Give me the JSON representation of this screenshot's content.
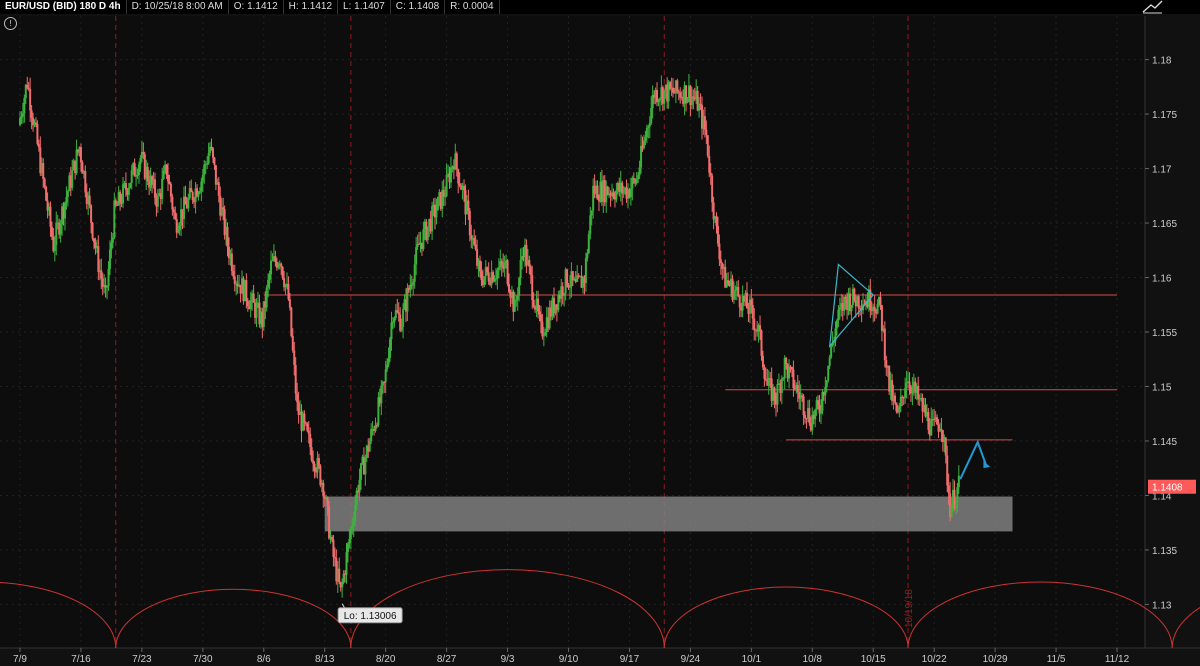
{
  "header": {
    "symbol": "EUR/USD (BID) 180 D 4h",
    "date": "D: 10/25/18 8:00 AM",
    "open": "O: 1.1412",
    "high": "H: 1.1412",
    "low": "L: 1.1407",
    "close": "C: 1.1408",
    "range": "R: 0.0004",
    "info_icon_glyph": "!"
  },
  "chart_data": {
    "type": "candlestick",
    "title": "",
    "ylim": [
      1.126,
      1.184
    ],
    "y_ticks": [
      "1.18",
      "1.175",
      "1.17",
      "1.165",
      "1.16",
      "1.155",
      "1.15",
      "1.145",
      "1.14",
      "1.135",
      "1.13"
    ],
    "x_ticks": [
      "7/9",
      "7/16",
      "7/23",
      "7/30",
      "8/6",
      "8/13",
      "8/20",
      "8/27",
      "9/3",
      "9/10",
      "9/17",
      "9/24",
      "10/1",
      "10/8",
      "10/15",
      "10/22",
      "10/29",
      "11/5",
      "11/12"
    ],
    "price_path": [
      [
        "7/9",
        1.174
      ],
      [
        "7/10",
        1.178
      ],
      [
        "7/12",
        1.168
      ],
      [
        "7/13",
        1.163
      ],
      [
        "7/16",
        1.172
      ],
      [
        "7/18",
        1.162
      ],
      [
        "7/19",
        1.158
      ],
      [
        "7/20",
        1.166
      ],
      [
        "7/23",
        1.171
      ],
      [
        "7/25",
        1.167
      ],
      [
        "7/26",
        1.17
      ],
      [
        "7/27",
        1.165
      ],
      [
        "7/30",
        1.169
      ],
      [
        "7/31",
        1.172
      ],
      [
        "8/2",
        1.163
      ],
      [
        "8/3",
        1.16
      ],
      [
        "8/6",
        1.156
      ],
      [
        "8/7",
        1.161
      ],
      [
        "8/8",
        1.162
      ],
      [
        "8/9",
        1.158
      ],
      [
        "8/10",
        1.148
      ],
      [
        "8/13",
        1.141
      ],
      [
        "8/14",
        1.135
      ],
      [
        "8/15",
        1.131
      ],
      [
        "8/16",
        1.136
      ],
      [
        "8/17",
        1.141
      ],
      [
        "8/20",
        1.15
      ],
      [
        "8/21",
        1.157
      ],
      [
        "8/22",
        1.156
      ],
      [
        "8/24",
        1.163
      ],
      [
        "8/27",
        1.168
      ],
      [
        "8/28",
        1.171
      ],
      [
        "8/29",
        1.168
      ],
      [
        "8/31",
        1.16
      ],
      [
        "9/3",
        1.161
      ],
      [
        "9/4",
        1.157
      ],
      [
        "9/5",
        1.163
      ],
      [
        "9/7",
        1.155
      ],
      [
        "9/10",
        1.16
      ],
      [
        "9/11",
        1.159
      ],
      [
        "9/12",
        1.16
      ],
      [
        "9/13",
        1.168
      ],
      [
        "9/17",
        1.168
      ],
      [
        "9/18",
        1.169
      ],
      [
        "9/20",
        1.177
      ],
      [
        "9/21",
        1.177
      ],
      [
        "9/24",
        1.177
      ],
      [
        "9/25",
        1.176
      ],
      [
        "9/26",
        1.173
      ],
      [
        "9/27",
        1.165
      ],
      [
        "9/28",
        1.16
      ],
      [
        "10/1",
        1.157
      ],
      [
        "10/2",
        1.155
      ],
      [
        "10/3",
        1.15
      ],
      [
        "10/4",
        1.149
      ],
      [
        "10/5",
        1.152
      ],
      [
        "10/8",
        1.147
      ],
      [
        "10/9",
        1.148
      ],
      [
        "10/10",
        1.152
      ],
      [
        "10/11",
        1.156
      ],
      [
        "10/12",
        1.158
      ],
      [
        "10/15",
        1.158
      ],
      [
        "10/16",
        1.157
      ],
      [
        "10/17",
        1.15
      ],
      [
        "10/18",
        1.147
      ],
      [
        "10/19",
        1.151
      ],
      [
        "10/22",
        1.146
      ],
      [
        "10/23",
        1.147
      ],
      [
        "10/24",
        1.139
      ],
      [
        "10/25",
        1.1408
      ]
    ],
    "horizontal_lines": [
      {
        "value": 1.1584,
        "from": "8/6",
        "to": "11/12"
      },
      {
        "value": 1.1497,
        "from": "9/28",
        "to": "11/12"
      },
      {
        "value": 1.1451,
        "from": "10/5",
        "to": "10/31"
      }
    ],
    "support_zone": {
      "from": "8/13",
      "to": "10/31",
      "low": 1.1367,
      "high": 1.1399
    },
    "vertical_markers": [
      "7/20/18",
      "8/16/18",
      "9/21/18",
      "10/19/18"
    ],
    "vertical_marker_label_date": "10/19/18",
    "low_annotation": {
      "label": "Lo: 1.13006",
      "date": "8/15",
      "value": 1.13006
    },
    "last_price_label": "1.1408",
    "triangle": [
      [
        "10/11",
        1.1612
      ],
      [
        "10/15",
        1.1584
      ],
      [
        "10/10",
        1.1537
      ]
    ],
    "projection_arrow": [
      [
        "10/25",
        1.1415
      ],
      [
        "10/27",
        1.1449
      ],
      [
        "10/28",
        1.1427
      ]
    ],
    "colors": {
      "up": "#3db33d",
      "down": "#f26d6d",
      "line": "#d94a4a",
      "zone": "#808080",
      "triangle": "#3fb8c8",
      "arrow": "#1f9ad6",
      "vline": "#8a1c1c",
      "price_tag": "#ff5a5a"
    }
  }
}
